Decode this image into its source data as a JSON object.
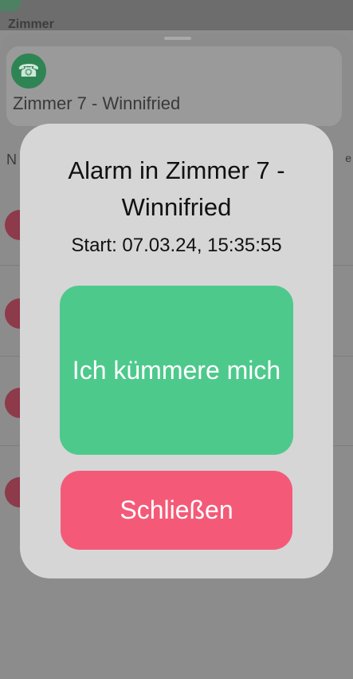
{
  "background": {
    "header_text": "Zimmer",
    "card": {
      "icon": "phone-icon",
      "title": "Zimmer 7 - Winnifried"
    },
    "section_label": "N",
    "section_right": "e"
  },
  "alarm_modal": {
    "title": "Alarm in Zimmer 7 - Winnifried",
    "start": "Start: 07.03.24, 15:35:55",
    "accept_label": "Ich kümmere mich",
    "close_label": "Schließen"
  },
  "colors": {
    "modal_bg": "#d6d6d6",
    "accept": "#4dc98c",
    "close": "#f45a78",
    "overlay": "#8c8c8c"
  }
}
